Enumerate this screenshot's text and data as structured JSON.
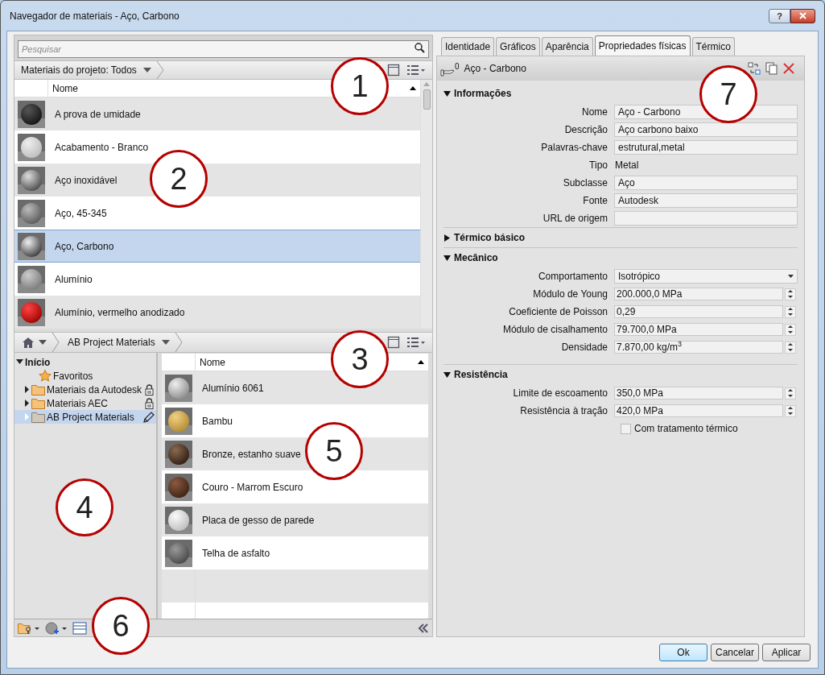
{
  "window": {
    "title": "Navegador de materiais - Aço, Carbono",
    "help": "?"
  },
  "search": {
    "placeholder": "Pesquisar"
  },
  "project_bar": {
    "label": "Materiais do projeto: Todos"
  },
  "project_table": {
    "columns": [
      "Nome"
    ],
    "rows": [
      {
        "name": "A prova de umidade",
        "selected": false
      },
      {
        "name": "Acabamento - Branco",
        "selected": false
      },
      {
        "name": "Aço inoxidável",
        "selected": false
      },
      {
        "name": "Aço, 45-345",
        "selected": false
      },
      {
        "name": "Aço, Carbono",
        "selected": true
      },
      {
        "name": "Alumínio",
        "selected": false
      },
      {
        "name": "Alumínio, vermelho anodizado",
        "selected": false
      }
    ]
  },
  "library_bar": {
    "label": "AB Project Materials"
  },
  "library_tree": [
    {
      "label": "Início",
      "expanded": true,
      "selected": false,
      "children": [
        {
          "label": "Favoritos",
          "kind": "favorites",
          "selected": false,
          "locked": false,
          "editable": false
        },
        {
          "label": "Materiais da Autodesk",
          "kind": "folder",
          "expanded": false,
          "selected": false,
          "locked": true,
          "editable": false
        },
        {
          "label": "Materiais AEC",
          "kind": "folder",
          "expanded": false,
          "selected": false,
          "locked": true,
          "editable": false
        },
        {
          "label": "AB Project Materials",
          "kind": "folder",
          "expanded": false,
          "selected": true,
          "locked": false,
          "editable": true
        }
      ]
    }
  ],
  "library_table": {
    "columns": [
      "Nome"
    ],
    "rows": [
      {
        "name": "Alumínio 6061",
        "selected": false
      },
      {
        "name": "Bambu",
        "selected": false
      },
      {
        "name": "Bronze, estanho suave",
        "selected": false
      },
      {
        "name": "Couro - Marrom Escuro",
        "selected": false
      },
      {
        "name": "Placa de gesso de parede",
        "selected": false
      },
      {
        "name": "Telha de asfalto",
        "selected": false
      }
    ]
  },
  "tabs": [
    {
      "label": "Identidade",
      "selected": false
    },
    {
      "label": "Gráficos",
      "selected": false
    },
    {
      "label": "Aparência",
      "selected": false
    },
    {
      "label": "Propriedades físicas",
      "selected": true
    },
    {
      "label": "Térmico",
      "selected": false
    }
  ],
  "asset": {
    "name": "Aço - Carbono",
    "count": "0"
  },
  "sections": [
    {
      "title": "Informações",
      "expanded": true,
      "fields": [
        {
          "kind": "text",
          "label": "Nome",
          "value": "Aço - Carbono"
        },
        {
          "kind": "text",
          "label": "Descrição",
          "value": "Aço carbono baixo"
        },
        {
          "kind": "text",
          "label": "Palavras-chave",
          "value": "estrutural,metal"
        },
        {
          "kind": "static",
          "label": "Tipo",
          "value": "Metal"
        },
        {
          "kind": "text",
          "label": "Subclasse",
          "value": "Aço"
        },
        {
          "kind": "text",
          "label": "Fonte",
          "value": "Autodesk"
        },
        {
          "kind": "text",
          "label": "URL de origem"
        }
      ]
    },
    {
      "title": "Térmico básico",
      "expanded": false
    },
    {
      "title": "Mecânico",
      "expanded": true,
      "fields": [
        {
          "kind": "select",
          "label": "Comportamento",
          "value": "Isotrópico"
        },
        {
          "kind": "spinner",
          "label": "Módulo de Young",
          "value": "200.000,0 MPa"
        },
        {
          "kind": "spinner",
          "label": "Coeficiente de Poisson",
          "value": "0,29"
        },
        {
          "kind": "spinner",
          "label": "Módulo de cisalhamento",
          "value": "79.700,0 MPa"
        },
        {
          "kind": "spinner",
          "label": "Densidade",
          "value": "7.870,00 kg/m$^{3}$"
        }
      ]
    },
    {
      "title": "Resistência",
      "expanded": true,
      "fields": [
        {
          "kind": "spinner",
          "label": "Limite de escoamento",
          "value": "350,0 MPa"
        },
        {
          "kind": "spinner",
          "label": "Resistência à tração",
          "value": "420,0 MPa"
        },
        {
          "kind": "checkbox",
          "label": "Com tratamento térmico",
          "checked": false
        }
      ]
    }
  ],
  "buttons": [
    {
      "label": "Ok",
      "default": true
    },
    {
      "label": "Cancelar",
      "default": false
    },
    {
      "label": "Aplicar",
      "default": false
    }
  ],
  "callouts": [
    {
      "label": "1"
    },
    {
      "label": "2"
    },
    {
      "label": "3"
    },
    {
      "label": "4"
    },
    {
      "label": "5"
    },
    {
      "label": "6"
    },
    {
      "label": "7"
    }
  ]
}
